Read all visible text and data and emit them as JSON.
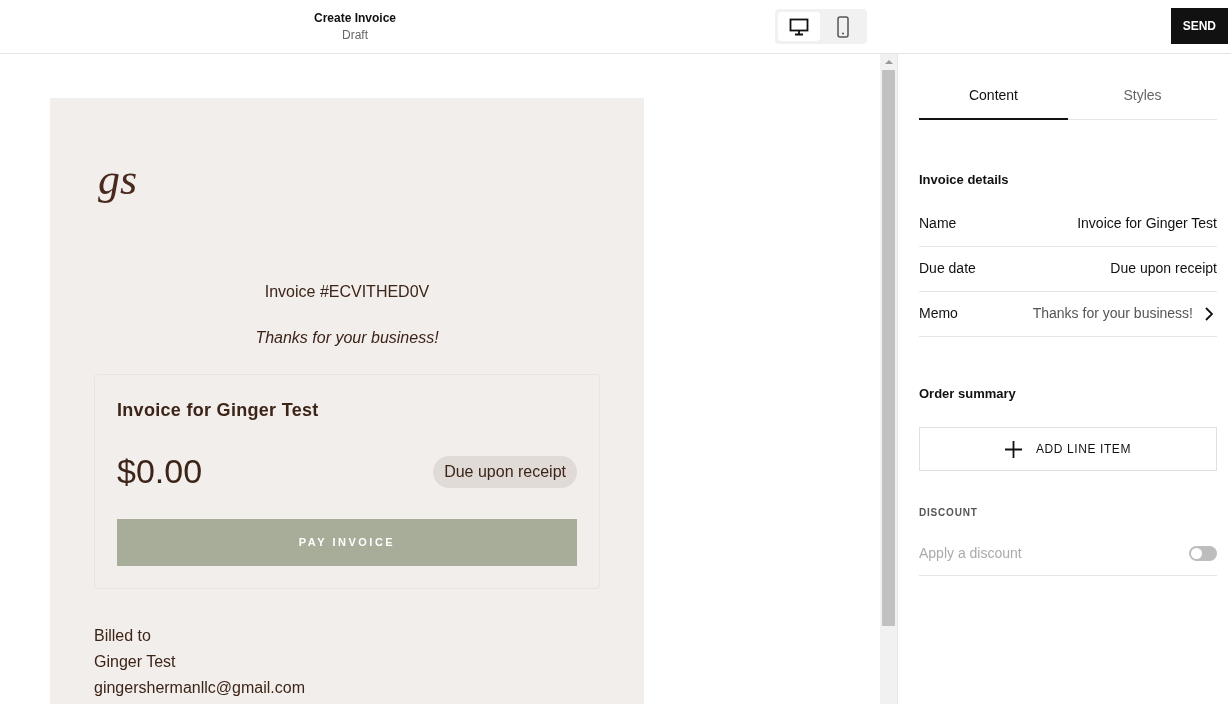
{
  "header": {
    "title": "Create Invoice",
    "subtitle": "Draft",
    "device_toggle": [
      {
        "kind": "desktop",
        "selected": true
      },
      {
        "kind": "mobile",
        "selected": false
      }
    ],
    "send_button": "SEND"
  },
  "preview": {
    "logo": "gs",
    "invoice_number": "Invoice #ECVITHED0V",
    "memo": "Thanks for your business!",
    "card": {
      "title": "Invoice for Ginger Test",
      "amount": "$0.00",
      "due_badge": "Due upon receipt",
      "pay_button": "PAY INVOICE"
    },
    "billed_to": [
      "Billed to",
      "Ginger Test",
      "gingershermanllc@gmail.com"
    ]
  },
  "panel": {
    "tabs": [
      {
        "label": "Content",
        "selected": true
      },
      {
        "label": "Styles",
        "selected": false
      }
    ],
    "invoice_details": {
      "heading": "Invoice details",
      "rows": [
        {
          "label": "Name",
          "value": "Invoice for Ginger Test",
          "has_chevron": false
        },
        {
          "label": "Due date",
          "value": "Due upon receipt",
          "has_chevron": false
        },
        {
          "label": "Memo",
          "value": "Thanks for your business!",
          "has_chevron": true
        }
      ]
    },
    "order_summary": {
      "heading": "Order summary",
      "add_button": "ADD LINE ITEM"
    },
    "discount": {
      "heading": "DISCOUNT",
      "label": "Apply a discount",
      "on": false
    }
  }
}
